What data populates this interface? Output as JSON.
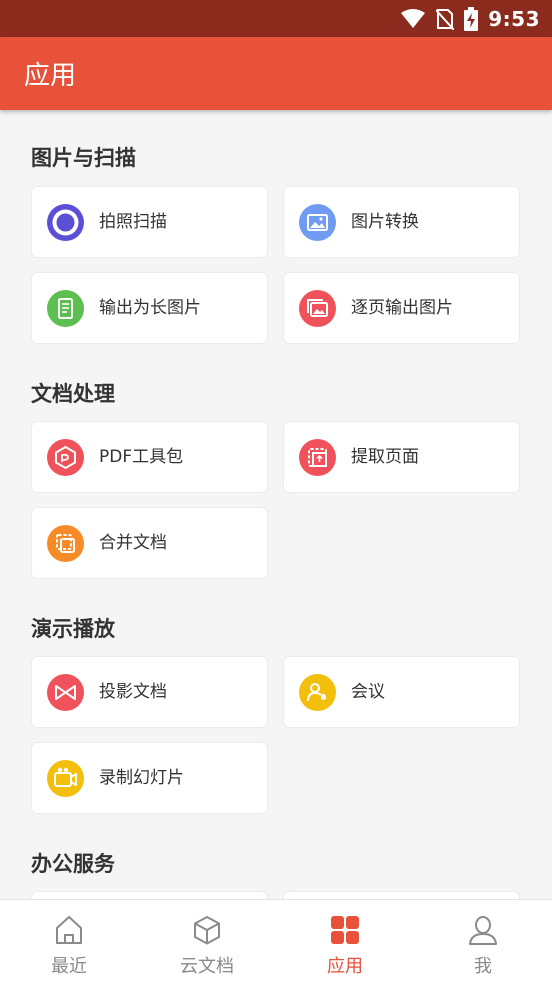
{
  "status": {
    "time": "9:53"
  },
  "header": {
    "title": "应用"
  },
  "sections": [
    {
      "title": "图片与扫描",
      "items": [
        {
          "label": "拍照扫描",
          "icon": "camera-scan-icon",
          "color": "#5b4fd6"
        },
        {
          "label": "图片转换",
          "icon": "image-convert-icon",
          "color": "#6f9cf2"
        },
        {
          "label": "输出为长图片",
          "icon": "long-image-icon",
          "color": "#5cbf4f"
        },
        {
          "label": "逐页输出图片",
          "icon": "page-image-icon",
          "color": "#f0525b"
        }
      ]
    },
    {
      "title": "文档处理",
      "items": [
        {
          "label": "PDF工具包",
          "icon": "pdf-toolkit-icon",
          "color": "#f0525b"
        },
        {
          "label": "提取页面",
          "icon": "extract-page-icon",
          "color": "#f0525b"
        },
        {
          "label": "合并文档",
          "icon": "merge-document-icon",
          "color": "#f78b27"
        }
      ]
    },
    {
      "title": "演示播放",
      "items": [
        {
          "label": "投影文档",
          "icon": "projector-icon",
          "color": "#f0525b"
        },
        {
          "label": "会议",
          "icon": "meeting-icon",
          "color": "#f4bf0c"
        },
        {
          "label": "录制幻灯片",
          "icon": "record-slide-icon",
          "color": "#f4bf0c"
        }
      ]
    },
    {
      "title": "办公服务",
      "items": []
    }
  ],
  "tabs": [
    {
      "label": "最近",
      "icon": "home-icon"
    },
    {
      "label": "云文档",
      "icon": "cloud-box-icon"
    },
    {
      "label": "应用",
      "icon": "apps-grid-icon",
      "active": true
    },
    {
      "label": "我",
      "icon": "profile-icon"
    }
  ],
  "colors": {
    "accent": "#e8523a",
    "statusbar": "#8a2b1d"
  }
}
